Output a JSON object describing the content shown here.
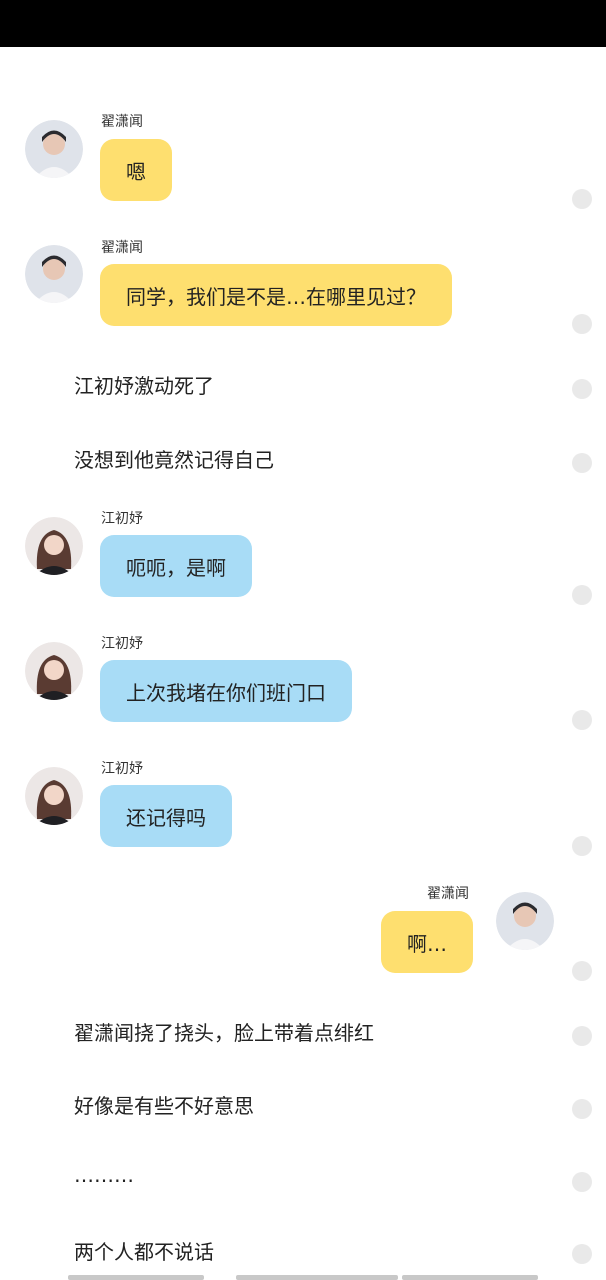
{
  "chat": {
    "m1": {
      "name": "翟潇闻",
      "text": "嗯"
    },
    "m2": {
      "name": "翟潇闻",
      "text": "同学，我们是不是…在哪里见过？"
    },
    "n1": "江初妤激动死了",
    "n2": "没想到他竟然记得自己",
    "m3": {
      "name": "江初妤",
      "text": "呃呃，是啊"
    },
    "m4": {
      "name": "江初妤",
      "text": "上次我堵在你们班门口"
    },
    "m5": {
      "name": "江初妤",
      "text": "还记得吗"
    },
    "m6": {
      "name": "翟潇闻",
      "text": "啊…"
    },
    "n3": "翟潇闻挠了挠头，脸上带着点绯红",
    "n4": "好像是有些不好意思",
    "n5": "………",
    "n6": "两个人都不说话"
  },
  "colors": {
    "yellow_bubble": "#fedf6f",
    "blue_bubble": "#a8dcf6",
    "status_bar": "#000000",
    "dot": "#e9e9e9"
  }
}
